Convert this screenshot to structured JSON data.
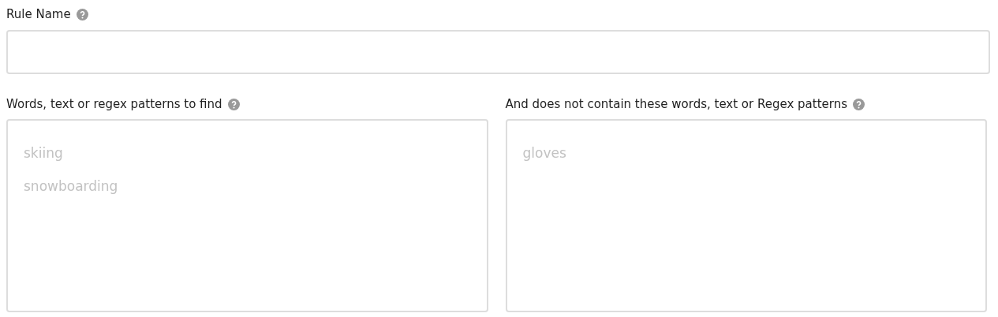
{
  "rule_name": {
    "label": "Rule Name"
  },
  "patterns": [
    {
      "label": "Words, text or regex patterns to find",
      "placeholder": "skiing\nsnowboarding"
    },
    {
      "label": "And does not contain these words, text or Regex patterns",
      "placeholder": "gloves"
    }
  ]
}
